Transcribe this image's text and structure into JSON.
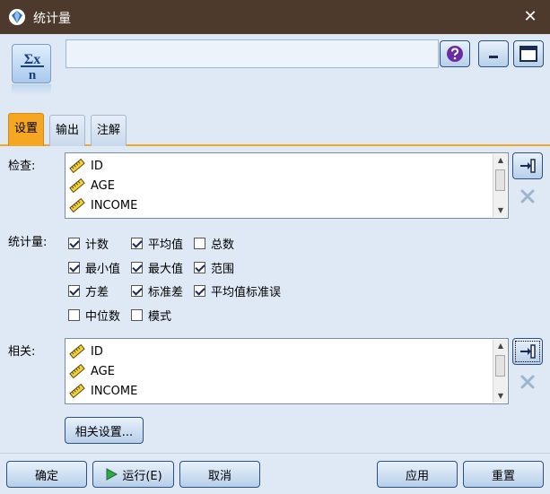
{
  "window": {
    "title": "统计量",
    "close_glyph": "✕"
  },
  "node": {
    "symbol_top": "Σx",
    "symbol_bottom": "n",
    "name_value": ""
  },
  "tabs": [
    {
      "label": "设置",
      "active": true
    },
    {
      "label": "输出",
      "active": false
    },
    {
      "label": "注解",
      "active": false
    }
  ],
  "examine": {
    "label": "检查:",
    "fields": [
      {
        "name": "ID"
      },
      {
        "name": "AGE"
      },
      {
        "name": "INCOME"
      }
    ]
  },
  "statistics": {
    "label": "统计量:",
    "options": [
      {
        "label": "计数",
        "checked": true
      },
      {
        "label": "平均值",
        "checked": true
      },
      {
        "label": "总数",
        "checked": false
      },
      {
        "label": "最小值",
        "checked": true
      },
      {
        "label": "最大值",
        "checked": true
      },
      {
        "label": "范围",
        "checked": true
      },
      {
        "label": "方差",
        "checked": true
      },
      {
        "label": "标准差",
        "checked": true
      },
      {
        "label": "平均值标准误",
        "checked": true
      },
      {
        "label": "中位数",
        "checked": false
      },
      {
        "label": "模式",
        "checked": false
      }
    ]
  },
  "correlate": {
    "label": "相关:",
    "fields": [
      {
        "name": "ID"
      },
      {
        "name": "AGE"
      },
      {
        "name": "INCOME"
      }
    ],
    "settings_button": "相关设置..."
  },
  "footer": {
    "ok": "确定",
    "run": "运行(E)",
    "cancel": "取消",
    "apply": "应用",
    "reset": "重置"
  },
  "colors": {
    "titlebar": "#4d3a2c",
    "panel": "#dfe9f5",
    "active_tab": "#f5a623",
    "button_border": "#2f4f7f"
  }
}
